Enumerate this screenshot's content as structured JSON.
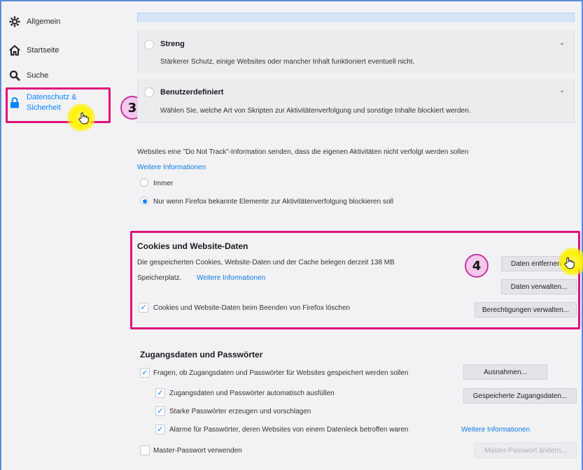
{
  "colors": {
    "accent": "#0a84ff",
    "highlight": "#e0107a",
    "badge": "#f3c8ec",
    "cursor": "#fff200"
  },
  "sidebar": {
    "items": [
      {
        "label": "Allgemein",
        "icon": "gear-icon"
      },
      {
        "label": "Startseite",
        "icon": "home-icon"
      },
      {
        "label": "Suche",
        "icon": "search-icon"
      },
      {
        "label": "Datenschutz & Sicherheit",
        "line1": "Datenschutz &",
        "line2": "Sicherheit",
        "icon": "lock-icon",
        "active": true
      }
    ]
  },
  "annotations": {
    "step3": "3",
    "step4": "4"
  },
  "tracking": {
    "strict": {
      "title": "Streng",
      "description": "Stärkerer Schutz, einige Websites oder mancher Inhalt funktioniert eventuell nicht."
    },
    "custom": {
      "title": "Benutzerdefiniert",
      "description": "Wählen Sie, welche Art von Skripten zur Aktivitätenverfolgung und sonstige Inhalte blockiert werden."
    }
  },
  "dnt": {
    "text": "Websites eine \"Do Not Track\"-Information senden, dass die eigenen Aktivitäten nicht verfolgt werden sollen",
    "link": "Weitere Informationen",
    "options": [
      {
        "label": "Immer",
        "checked": false
      },
      {
        "label": "Nur wenn Firefox bekannte Elemente zur Aktivitätenverfolgung blockieren soll",
        "checked": true
      }
    ]
  },
  "cookies": {
    "title": "Cookies und Website-Daten",
    "usage_text": "Die gespeicherten Cookies, Website-Daten und der Cache belegen derzeit 138 MB",
    "usage_text2": "Speicherplatz.",
    "link": "Weitere Informationen",
    "checkbox_label": "Cookies und Website-Daten beim Beenden von Firefox löschen",
    "checkbox_checked": true,
    "buttons": {
      "clear": "Daten entfernen...",
      "manage": "Daten verwalten...",
      "permissions": "Berechtigungen verwalten..."
    }
  },
  "logins": {
    "title": "Zugangsdaten und Passwörter",
    "ask_label": "Fragen, ob Zugangsdaten und Passwörter für Websites gespeichert werden sollen",
    "autofill_label": "Zugangsdaten und Passwörter automatisch ausfüllen",
    "suggest_label": "Starke Passwörter erzeugen und vorschlagen",
    "alerts_label": "Alarme für Passwörter, deren Websites von einem Datenleck betroffen waren",
    "alerts_link": "Weitere Informationen",
    "master_label": "Master-Passwort verwenden",
    "buttons": {
      "exceptions": "Ausnahmen...",
      "saved": "Gespeicherte Zugangsdaten...",
      "master": "Master-Passwort ändern..."
    }
  }
}
